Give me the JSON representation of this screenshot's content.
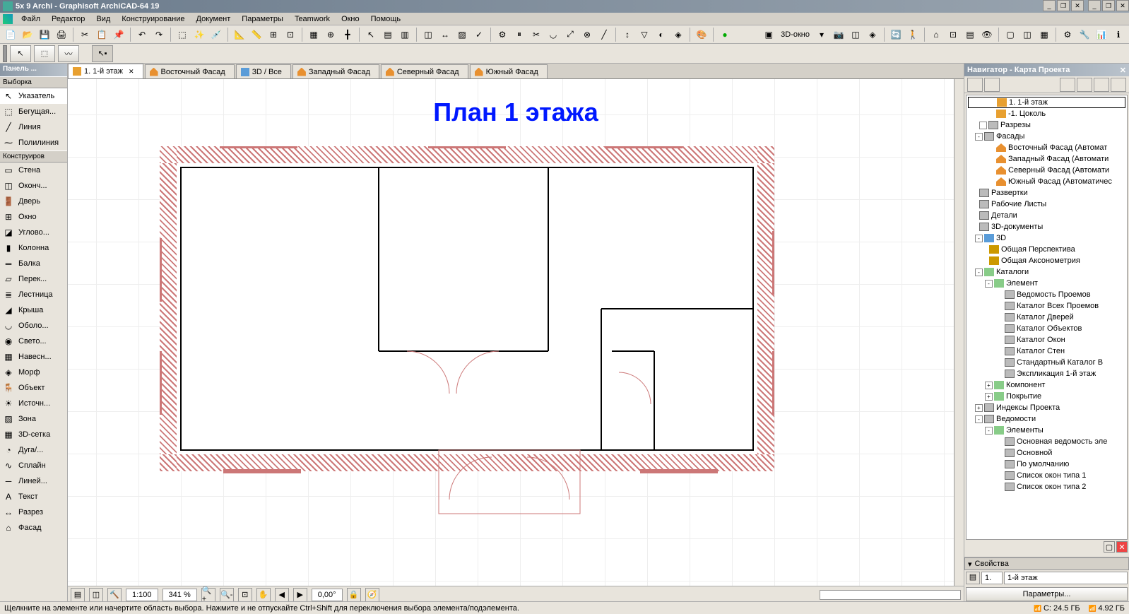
{
  "title": "5x 9 Archi - Graphisoft ArchiCAD-64 19",
  "menu": [
    "Файл",
    "Редактор",
    "Вид",
    "Конструирование",
    "Документ",
    "Параметры",
    "Teamwork",
    "Окно",
    "Помощь"
  ],
  "toolbar_3d_label": "3D-окно",
  "toolbox": {
    "header": "Панель ...",
    "sections": {
      "selection": "Выборка",
      "design": "Конструиров"
    },
    "selection_tools": [
      {
        "icon": "↖",
        "label": "Указатель",
        "active": true
      },
      {
        "icon": "⬚",
        "label": "Бегущая..."
      },
      {
        "icon": "╱",
        "label": "Линия"
      },
      {
        "icon": "⁓",
        "label": "Полилиния"
      }
    ],
    "design_tools": [
      {
        "icon": "▭",
        "label": "Стена"
      },
      {
        "icon": "◫",
        "label": "Оконч..."
      },
      {
        "icon": "🚪",
        "label": "Дверь"
      },
      {
        "icon": "⊞",
        "label": "Окно"
      },
      {
        "icon": "◪",
        "label": "Углово..."
      },
      {
        "icon": "▮",
        "label": "Колонна"
      },
      {
        "icon": "═",
        "label": "Балка"
      },
      {
        "icon": "▱",
        "label": "Перек..."
      },
      {
        "icon": "≣",
        "label": "Лестница"
      },
      {
        "icon": "◢",
        "label": "Крыша"
      },
      {
        "icon": "◡",
        "label": "Оболо..."
      },
      {
        "icon": "◉",
        "label": "Свето..."
      },
      {
        "icon": "▦",
        "label": "Навесн..."
      },
      {
        "icon": "◈",
        "label": "Морф"
      },
      {
        "icon": "🪑",
        "label": "Объект"
      },
      {
        "icon": "☀",
        "label": "Источн..."
      },
      {
        "icon": "▨",
        "label": "Зона"
      },
      {
        "icon": "▦",
        "label": "3D-сетка"
      },
      {
        "icon": "◔",
        "label": "Дуга/..."
      },
      {
        "icon": "∿",
        "label": "Сплайн"
      },
      {
        "icon": "─",
        "label": "Линей..."
      },
      {
        "icon": "A",
        "label": "Текст"
      },
      {
        "icon": "↔",
        "label": "Разрез"
      },
      {
        "icon": "⌂",
        "label": "Фасад"
      }
    ]
  },
  "tabs": [
    {
      "icon": "folder",
      "label": "1. 1-й этаж",
      "active": true,
      "closable": true
    },
    {
      "icon": "facade",
      "label": "Восточный Фасад"
    },
    {
      "icon": "cube",
      "label": "3D / Все"
    },
    {
      "icon": "facade",
      "label": "Западный Фасад"
    },
    {
      "icon": "facade",
      "label": "Северный Фасад"
    },
    {
      "icon": "facade",
      "label": "Южный Фасад"
    }
  ],
  "drawing_title": "План 1 этажа",
  "view_controls": {
    "scale": "1:100",
    "zoom": "341 %",
    "angle": "0,00°"
  },
  "navigator": {
    "header": "Навигатор - Карта Проекта",
    "tree": [
      {
        "ind": 40,
        "icon": "ti-folder",
        "label": "1. 1-й этаж",
        "selected": true
      },
      {
        "ind": 40,
        "icon": "ti-folder",
        "label": "-1. Цоколь"
      },
      {
        "ind": 16,
        "toggle": "",
        "icon": "ti-doc",
        "label": "Разрезы"
      },
      {
        "ind": 10,
        "toggle": "-",
        "icon": "ti-doc",
        "label": "Фасады"
      },
      {
        "ind": 40,
        "icon": "ti-facade",
        "label": "Восточный Фасад (Автомат"
      },
      {
        "ind": 40,
        "icon": "ti-facade",
        "label": "Западный Фасад (Автомати"
      },
      {
        "ind": 40,
        "icon": "ti-facade",
        "label": "Северный Фасад (Автомати"
      },
      {
        "ind": 40,
        "icon": "ti-facade",
        "label": "Южный Фасад (Автоматичес"
      },
      {
        "ind": 16,
        "icon": "ti-doc",
        "label": "Развертки"
      },
      {
        "ind": 16,
        "icon": "ti-doc",
        "label": "Рабочие Листы"
      },
      {
        "ind": 16,
        "icon": "ti-doc",
        "label": "Детали"
      },
      {
        "ind": 16,
        "icon": "ti-doc",
        "label": "3D-документы"
      },
      {
        "ind": 10,
        "toggle": "-",
        "icon": "ti-3d",
        "label": "3D"
      },
      {
        "ind": 30,
        "icon": "ti-cam",
        "label": "Общая Перспектива"
      },
      {
        "ind": 30,
        "icon": "ti-cam",
        "label": "Общая Аксонометрия"
      },
      {
        "ind": 10,
        "toggle": "-",
        "icon": "ti-list",
        "label": "Каталоги"
      },
      {
        "ind": 24,
        "toggle": "-",
        "icon": "ti-list",
        "label": "Элемент"
      },
      {
        "ind": 52,
        "icon": "ti-doc",
        "label": "Ведомость Проемов"
      },
      {
        "ind": 52,
        "icon": "ti-doc",
        "label": "Каталог Всех Проемов"
      },
      {
        "ind": 52,
        "icon": "ti-doc",
        "label": "Каталог Дверей"
      },
      {
        "ind": 52,
        "icon": "ti-doc",
        "label": "Каталог Объектов"
      },
      {
        "ind": 52,
        "icon": "ti-doc",
        "label": "Каталог Окон"
      },
      {
        "ind": 52,
        "icon": "ti-doc",
        "label": "Каталог Стен"
      },
      {
        "ind": 52,
        "icon": "ti-doc",
        "label": "Стандартный Каталог В"
      },
      {
        "ind": 52,
        "icon": "ti-doc",
        "label": "Экспликация 1-й этаж"
      },
      {
        "ind": 24,
        "toggle": "+",
        "icon": "ti-list",
        "label": "Компонент"
      },
      {
        "ind": 24,
        "toggle": "+",
        "icon": "ti-list",
        "label": "Покрытие"
      },
      {
        "ind": 10,
        "toggle": "+",
        "icon": "ti-doc",
        "label": "Индексы Проекта"
      },
      {
        "ind": 10,
        "toggle": "-",
        "icon": "ti-doc",
        "label": "Ведомости"
      },
      {
        "ind": 24,
        "toggle": "-",
        "icon": "ti-list",
        "label": "Элементы"
      },
      {
        "ind": 52,
        "icon": "ti-doc",
        "label": "Основная ведомость эле"
      },
      {
        "ind": 52,
        "icon": "ti-doc",
        "label": "Основной"
      },
      {
        "ind": 52,
        "icon": "ti-doc",
        "label": "По умолчанию"
      },
      {
        "ind": 52,
        "icon": "ti-doc",
        "label": "Список окон типа 1"
      },
      {
        "ind": 52,
        "icon": "ti-doc",
        "label": "Список окон типа 2"
      }
    ],
    "props_header": "Свойства",
    "props_id": "1.",
    "props_name": "1-й этаж",
    "props_button": "Параметры..."
  },
  "statusbar": {
    "hint": "Щелкните на элементе или начертите область выбора. Нажмите и не отпускайте Ctrl+Shift для переключения выбора элемента/подэлемента.",
    "disk": "C: 24.5 ГБ",
    "ram": "4.92 ГБ"
  }
}
